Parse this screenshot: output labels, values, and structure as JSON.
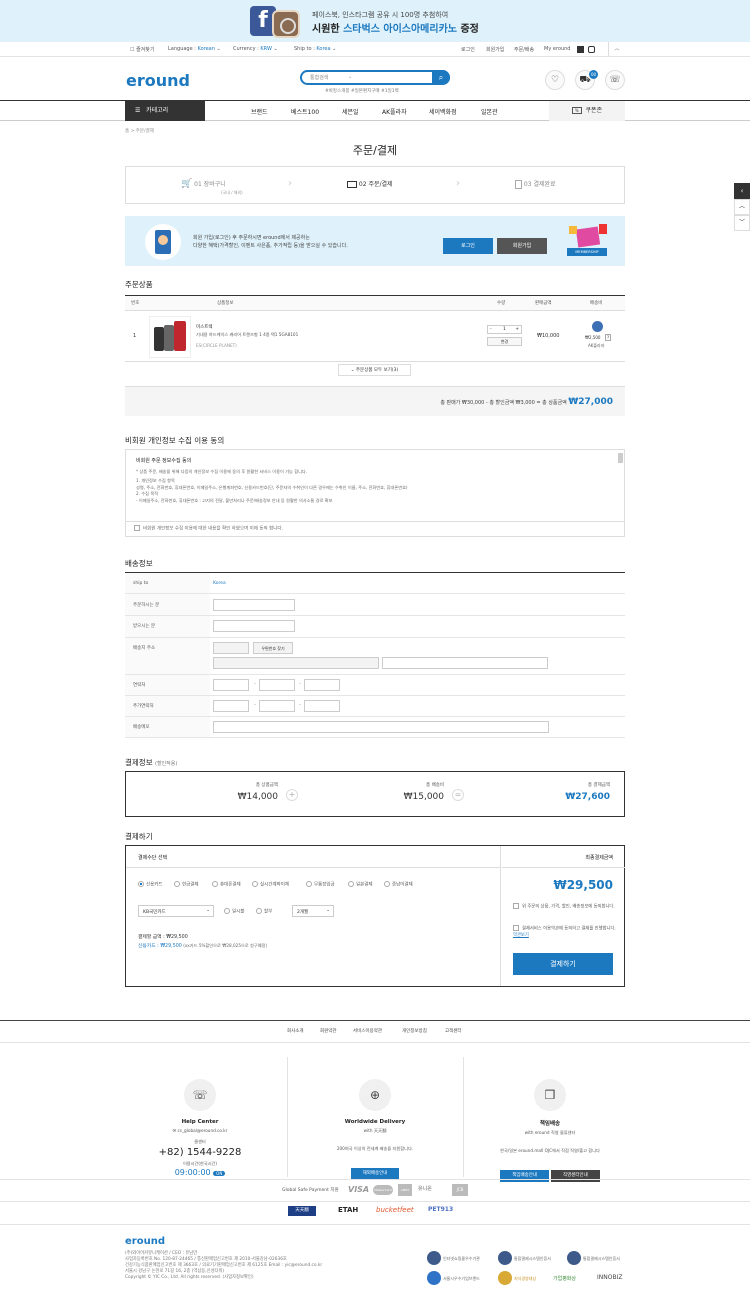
{
  "promo": {
    "line1": "페이스북, 인스타그램 공유 시 100명 추첨하여",
    "line2a": "시원한 ",
    "line2b": "스타벅스 아이스아메리카노",
    "line2c": " 증정"
  },
  "topbar": {
    "bookmark": "즐겨찾기",
    "language_label": "Language :",
    "language": "Korean",
    "currency_label": "Currency :",
    "currency": "KRW",
    "shipto_label": "Ship to :",
    "shipto": "Korea",
    "login": "로그인",
    "join": "회원가입",
    "order": "주문/배송",
    "myeround": "My eround"
  },
  "brand": "eround",
  "search": {
    "placeholder": "통합검색",
    "tags": "#바캉스개봉  #일본편지구매  #1일1벽"
  },
  "nav": {
    "category": "카테고리",
    "items": [
      "브랜드",
      "베스트100",
      "세븐일",
      "AK플라자",
      "세이백화점",
      "일본관"
    ],
    "coupon": "쿠폰존"
  },
  "breadcrumb": "홈 > 주문/결제",
  "title": "주문/결제",
  "steps": [
    {
      "label": "01 장바구니",
      "sub": "(국내 / 해외)"
    },
    {
      "label": "02 주문/결제",
      "sub": ""
    },
    {
      "label": "03 결제완료",
      "sub": ""
    }
  ],
  "member": {
    "text1": "회원 가입(로그인) 후 주문하시면 eround에서 제공하는",
    "text2": "다양한 혜택(가격할인, 이벤트 사은품, 추가적립 등)을 받으실 수 있습니다.",
    "login": "로그인",
    "join": "회원가입",
    "badge": "MEMBERSHIP"
  },
  "order_products": {
    "title": "주문상품",
    "headers": [
      "번호",
      "상품정보",
      "수량",
      "판매금액",
      "배송비"
    ],
    "item": {
      "no": "1",
      "brand": "미스트렉",
      "name": "기내용 하드케이스 캐리어 트렌즈형 1 4종 택1 5GA8101",
      "option": "ES(CIRCLE PLANET)",
      "qty": "1",
      "change": "변경",
      "price": "₩10,000",
      "ship_fee": "₩2,500",
      "ship_note": "AK플라자"
    },
    "show_all": "주문상품 모두 보기(3)",
    "summary_pre": "총 판매가 ₩30,000 - 총 할인금액 ₩3,000 = 총 상품금액",
    "summary_total": "₩27,000"
  },
  "agreement": {
    "title": "비회원 개인정보 수집 이용 동의",
    "box_title": "비회원 주문 정보수집 동의",
    "lines": [
      "* 상품 주문, 배송을 위해 다음의 개인정보 수집 이용에 동의 후 원활한 서비스 이용이 가능 합니다.",
      "1. 개인정보 수집 항목",
      "   성명, 주소, 전화번호, 휴대폰번호, 이메일주소, 은행계좌번호, 신용카드번호(단, 주문자의 수취인이 다른 경우에는 수취인 이름, 주소, 전화번호, 휴대폰번호)",
      "2. 수집 목적",
      "   - 이메일주소, 전화번호, 휴대폰번호 : 고지의 전달, 불만처리나 주문/배송정보 안내 등 원활한 의사소통 경로 확보"
    ],
    "check": "비회원 개인정보 수집 이용에 대한 내용을 확인 하였으며 이에 동의 합니다."
  },
  "shipping": {
    "title": "배송정보",
    "shipto_label": "ship to",
    "shipto_value": "Korea",
    "orderer": "주문하시는 분",
    "receiver": "받으시는 분",
    "address": "배송지 주소",
    "zipcode_btn": "우편번호 찾기",
    "phone": "연락처",
    "phone2": "추가연락처",
    "memo": "배송메모"
  },
  "payinfo": {
    "title": "결제정보",
    "title_sub": "(할인적용)",
    "total_product_label": "총 상품금액",
    "total_product": "₩14,000",
    "total_ship_label": "총 배송비",
    "total_ship": "₩15,000",
    "total_pay_label": "총 결제금액",
    "total_pay": "₩27,600"
  },
  "method": {
    "title": "결제하기",
    "header": "결제수단 선택",
    "options": [
      "신용카드",
      "현금결제",
      "휴대폰결제",
      "실시간계좌이체",
      "무통장입금",
      "일본결제",
      "중남미결제"
    ],
    "card_select": "KB국민카드",
    "lump": "일시불",
    "install": "할부",
    "install_select": "2개월",
    "amount_line": "결제할 금액 : ₩29,500",
    "card_line_pre": "신용카드 : ₩29,500",
    "card_line_post": " (xx카드 5%할인으로 ₩28,025으로 청구예정)",
    "final_label": "최종결제금액",
    "final_amount": "₩29,500",
    "notice1": "위 주문의 상품, 가격, 할인, 배송정보에 동의합니다.",
    "notice2": "결제서비스 이용약관에 동의하고 결제를 진행합니다.",
    "terms_link": "약관보기",
    "pay_button": "결제하기"
  },
  "footer": {
    "links": [
      "회사소개",
      "회원약관",
      "서비스이용약관",
      "개인정보방침",
      "고객센터"
    ],
    "help_title": "Help Center",
    "help_email": "cs_global@eround.co.kr",
    "help_phone_label": "클센터",
    "help_phone": "+82) 1544-9228",
    "help_hours_label": "이용시간(한국시간)",
    "help_hours": "09:00:00",
    "help_badge": "ON",
    "ww_title": "Worldwide Delivery",
    "ww_sub": "with 天天翻",
    "ww_desc": "200여국 이상의 전세계 배송을 지원합니다.",
    "ww_btn": "해외배송안내",
    "rs_title": "책임배송",
    "rs_sub": "with eround 직영 물류센터",
    "rs_desc": "한국/일본 eround.mall OJC에서 직접 직영/출고 합니다",
    "rs_btn1": "책임배송안내",
    "rs_btn2": "직영센터안내",
    "pay_label": "Global Safe Payment 지원",
    "pay_logos": [
      "VISA",
      "MasterCard",
      "AMEX",
      "유니온",
      "JCB"
    ],
    "partners": [
      "天天翻",
      "ETAH",
      "bucketfeet",
      "PET913"
    ],
    "brand": "eround",
    "info": [
      "(주)와이어커뮤니케이션 / CEO : 유남만",
      "사업자등록번호 No. 120-87-24465 / 통신판매업신고번호 제 2010-서울강남-02636호",
      "건강기능식품판매업신고번호 제 3663호 / 의료기기판매업신고번호 제 6125호 Email : yic@eround.co.kr",
      "서울시 강남구 논현로 71길 16, 2층 (역삼동,신성타워)",
      "Copyright © YIC Co., Ltd. All rights reserved. (사업자정보확인)"
    ],
    "certs": [
      "인터넷쇼핑몰우수기관",
      "통합결제시스템인증서",
      "통합결제시스템인증서",
      "서울시우수기업브랜드",
      "지식경영대상",
      "가업평화상",
      "INNOBIZ"
    ]
  }
}
